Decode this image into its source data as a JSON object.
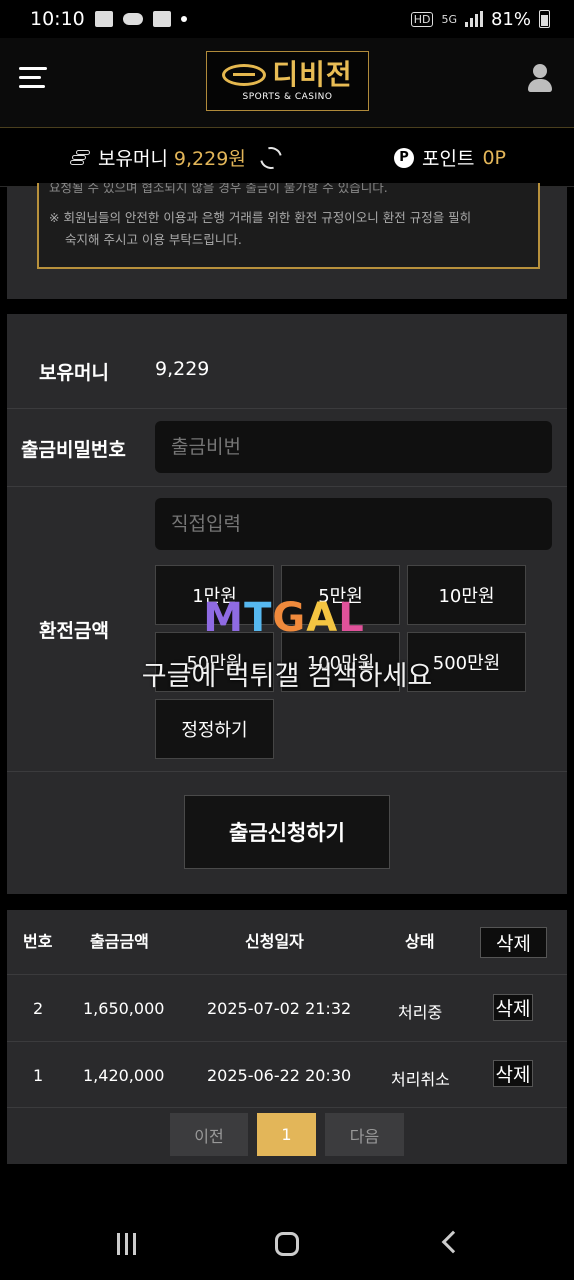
{
  "status_bar": {
    "time": "10:10",
    "hd": "HD",
    "net": "5G",
    "battery": "81%"
  },
  "header": {
    "logo_text": "디비전",
    "logo_sub": "SPORTS & CASINO"
  },
  "balance": {
    "money_label": "보유머니",
    "money_value": "9,229원",
    "point_icon": "P",
    "point_label": "포인트",
    "point_value": "0P"
  },
  "notice": {
    "line_cut": "요청될 수 있으며 협조되지 않을 경우 출금이 불가할 수 있습니다.",
    "line1": "※ 회원님들의 안전한 이용과 은행 거래를 위한 환전 규정이오니 환전 규정을 필히",
    "line2": "숙지해 주시고 이용 부탁드립니다."
  },
  "form": {
    "balance_label": "보유머니",
    "balance_value": "9,229",
    "password_label": "출금비밀번호",
    "password_placeholder": "출금비번",
    "amount_label": "환전금액",
    "amount_placeholder": "직접입력",
    "amount_buttons": [
      "1만원",
      "5만원",
      "10만원",
      "50만원",
      "100만원",
      "500만원"
    ],
    "reset_button": "정정하기",
    "submit_button": "출금신청하기"
  },
  "watermark": {
    "logo": [
      "M",
      "T",
      "G",
      "A",
      "L"
    ],
    "text": "구글에 먹튀갤 검색하세요"
  },
  "history": {
    "headers": [
      "번호",
      "출금금액",
      "신청일자",
      "상태"
    ],
    "delete_all": "삭제",
    "rows": [
      {
        "no": "2",
        "amount": "1,650,000",
        "date": "2025-07-02 21:32",
        "status": "처리중",
        "action": "삭제"
      },
      {
        "no": "1",
        "amount": "1,420,000",
        "date": "2025-06-22 20:30",
        "status": "처리취소",
        "action": "삭제"
      }
    ],
    "pagination": {
      "prev": "이전",
      "current": "1",
      "next": "다음"
    }
  },
  "colors": {
    "accent_gold": "#e3b659",
    "panel": "#2a2a2c",
    "background": "#000000"
  }
}
